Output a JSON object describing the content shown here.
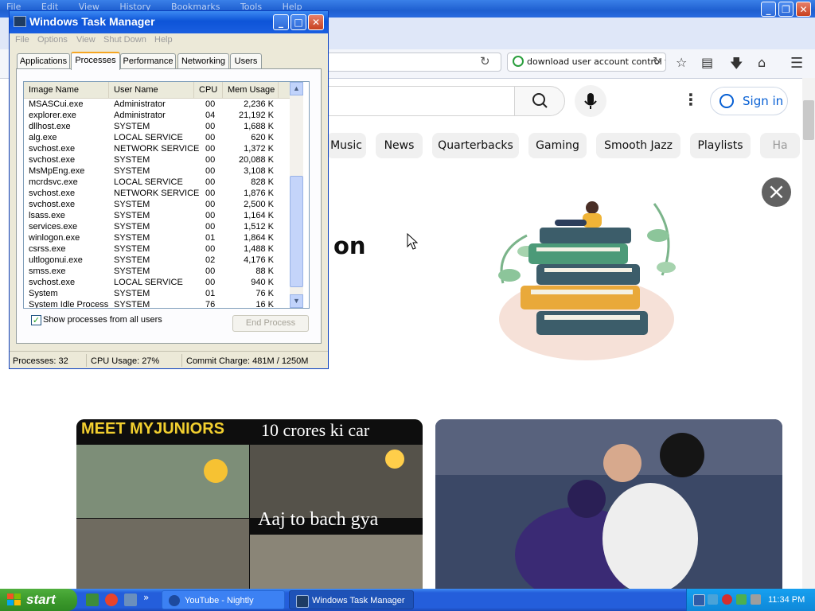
{
  "browser": {
    "menu": [
      "File",
      "Edit",
      "View",
      "History",
      "Bookmarks",
      "Tools",
      "Help"
    ],
    "search_box_text": "download user account control f",
    "page": {
      "signin_label": "Sign in",
      "chips": [
        "Music",
        "News",
        "Quarterbacks",
        "Gaming",
        "Smooth Jazz",
        "Playlists",
        "Ha"
      ],
      "promo_text": "on",
      "thumb1_top_left": "MEET MYJUNIORS",
      "thumb1_top_right": "10 crores ki car",
      "thumb1_middle": "Aaj to bach gya"
    }
  },
  "task_manager": {
    "title": "Windows Task Manager",
    "menu": [
      "File",
      "Options",
      "View",
      "Shut Down",
      "Help"
    ],
    "tabs": [
      "Applications",
      "Processes",
      "Performance",
      "Networking",
      "Users"
    ],
    "active_tab": "Processes",
    "columns": [
      "Image Name",
      "User Name",
      "CPU",
      "Mem Usage"
    ],
    "processes": [
      {
        "image": "MSASCui.exe",
        "user": "Administrator",
        "cpu": "00",
        "mem": "2,236 K"
      },
      {
        "image": "explorer.exe",
        "user": "Administrator",
        "cpu": "04",
        "mem": "21,192 K"
      },
      {
        "image": "dllhost.exe",
        "user": "SYSTEM",
        "cpu": "00",
        "mem": "1,688 K"
      },
      {
        "image": "alg.exe",
        "user": "LOCAL SERVICE",
        "cpu": "00",
        "mem": "620 K"
      },
      {
        "image": "svchost.exe",
        "user": "NETWORK SERVICE",
        "cpu": "00",
        "mem": "1,372 K"
      },
      {
        "image": "svchost.exe",
        "user": "SYSTEM",
        "cpu": "00",
        "mem": "20,088 K"
      },
      {
        "image": "MsMpEng.exe",
        "user": "SYSTEM",
        "cpu": "00",
        "mem": "3,108 K"
      },
      {
        "image": "mcrdsvc.exe",
        "user": "LOCAL SERVICE",
        "cpu": "00",
        "mem": "828 K"
      },
      {
        "image": "svchost.exe",
        "user": "NETWORK SERVICE",
        "cpu": "00",
        "mem": "1,876 K"
      },
      {
        "image": "svchost.exe",
        "user": "SYSTEM",
        "cpu": "00",
        "mem": "2,500 K"
      },
      {
        "image": "lsass.exe",
        "user": "SYSTEM",
        "cpu": "00",
        "mem": "1,164 K"
      },
      {
        "image": "services.exe",
        "user": "SYSTEM",
        "cpu": "00",
        "mem": "1,512 K"
      },
      {
        "image": "winlogon.exe",
        "user": "SYSTEM",
        "cpu": "01",
        "mem": "1,864 K"
      },
      {
        "image": "csrss.exe",
        "user": "SYSTEM",
        "cpu": "00",
        "mem": "1,488 K"
      },
      {
        "image": "ultlogonui.exe",
        "user": "SYSTEM",
        "cpu": "02",
        "mem": "4,176 K"
      },
      {
        "image": "smss.exe",
        "user": "SYSTEM",
        "cpu": "00",
        "mem": "88 K"
      },
      {
        "image": "svchost.exe",
        "user": "LOCAL SERVICE",
        "cpu": "00",
        "mem": "940 K"
      },
      {
        "image": "System",
        "user": "SYSTEM",
        "cpu": "01",
        "mem": "76 K"
      },
      {
        "image": "System Idle Process",
        "user": "SYSTEM",
        "cpu": "76",
        "mem": "16 K"
      }
    ],
    "show_all_label": "Show processes from all users",
    "show_all_checked": true,
    "end_process_label": "End Process",
    "status": {
      "processes": "Processes: 32",
      "cpu": "CPU Usage: 27%",
      "commit": "Commit Charge: 481M / 1250M"
    }
  },
  "taskbar": {
    "start_label": "start",
    "overflow": "»",
    "tasks": [
      "YouTube - Nightly",
      "Windows Task Manager"
    ],
    "clock": "11:34 PM"
  }
}
